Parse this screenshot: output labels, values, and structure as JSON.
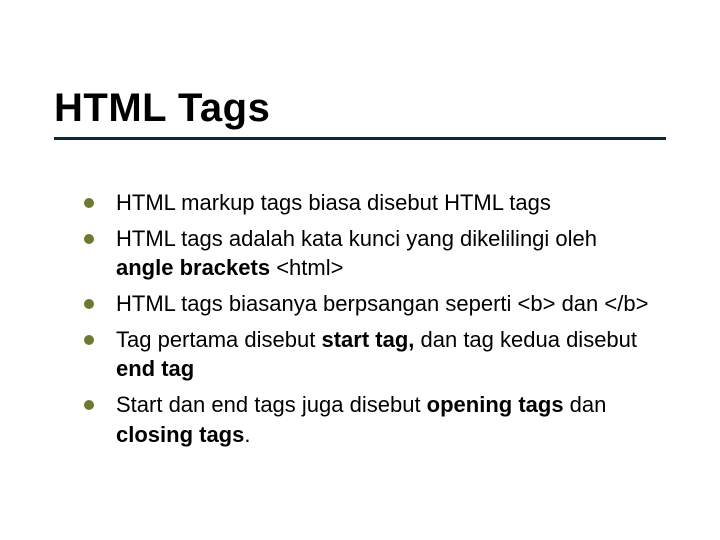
{
  "slide": {
    "title": "HTML Tags",
    "bullets": [
      {
        "parts": [
          {
            "text": "HTML markup tags biasa disebut HTML tags",
            "bold": false
          }
        ]
      },
      {
        "parts": [
          {
            "text": "HTML tags adalah kata kunci yang dikelilingi  oleh ",
            "bold": false
          },
          {
            "text": "angle brackets",
            "bold": true
          },
          {
            "text": " <html>",
            "bold": false
          }
        ]
      },
      {
        "parts": [
          {
            "text": "HTML tags biasanya berpsangan seperti <b> dan </b>",
            "bold": false
          }
        ]
      },
      {
        "parts": [
          {
            "text": "Tag pertama disebut  ",
            "bold": false
          },
          {
            "text": "start tag,",
            "bold": true
          },
          {
            "text": " dan tag kedua disebut ",
            "bold": false
          },
          {
            "text": "end tag",
            "bold": true
          }
        ]
      },
      {
        "parts": [
          {
            "text": "Start dan end tags juga disebut ",
            "bold": false
          },
          {
            "text": "opening tags",
            "bold": true
          },
          {
            "text": " dan ",
            "bold": false
          },
          {
            "text": "closing tags",
            "bold": true
          },
          {
            "text": ".",
            "bold": false
          }
        ]
      }
    ]
  }
}
